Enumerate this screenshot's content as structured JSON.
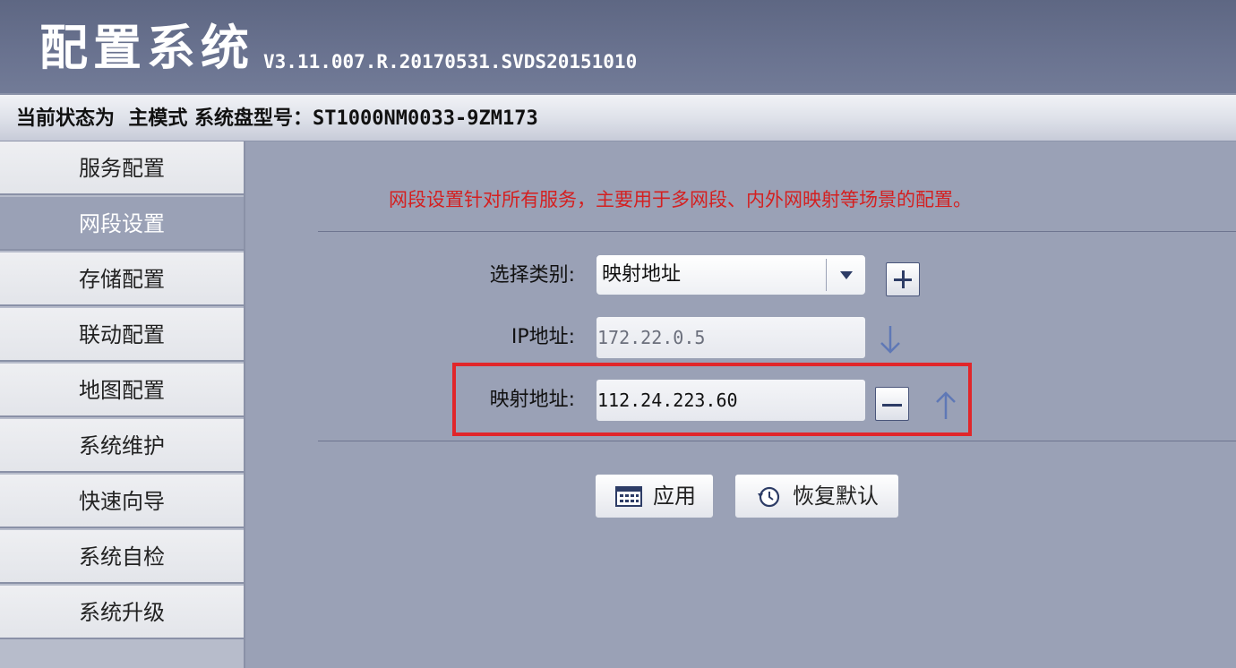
{
  "header": {
    "title": "配置系统",
    "version": "V3.11.007.R.20170531.SVDS20151010"
  },
  "status": {
    "prefix": "当前状态为",
    "mode": "主模式",
    "disk_label": "系统盘型号：",
    "disk_model": "ST1000NM0033-9ZM173"
  },
  "sidebar": {
    "items": [
      {
        "label": "服务配置",
        "active": false
      },
      {
        "label": "网段设置",
        "active": true
      },
      {
        "label": "存储配置",
        "active": false
      },
      {
        "label": "联动配置",
        "active": false
      },
      {
        "label": "地图配置",
        "active": false
      },
      {
        "label": "系统维护",
        "active": false
      },
      {
        "label": "快速向导",
        "active": false
      },
      {
        "label": "系统自检",
        "active": false
      },
      {
        "label": "系统升级",
        "active": false
      }
    ]
  },
  "main": {
    "notice": "网段设置针对所有服务，主要用于多网段、内外网映射等场景的配置。",
    "category_label": "选择类别:",
    "category_value": "映射地址",
    "ip_label": "IP地址:",
    "ip_value": "172.22.0.5",
    "mapped_label": "映射地址:",
    "mapped_value": "112.24.223.60",
    "apply_label": "应用",
    "restore_label": "恢复默认"
  },
  "colors": {
    "highlight": "#e1262a",
    "notice": "#d42020",
    "header_bg": "#646d8a",
    "panel_bg": "#9aa1b6"
  },
  "icons": [
    "plus-icon",
    "minus-icon",
    "arrow-down-icon",
    "arrow-up-icon",
    "calendar-icon",
    "restore-clock-icon",
    "dropdown-triangle-icon"
  ]
}
